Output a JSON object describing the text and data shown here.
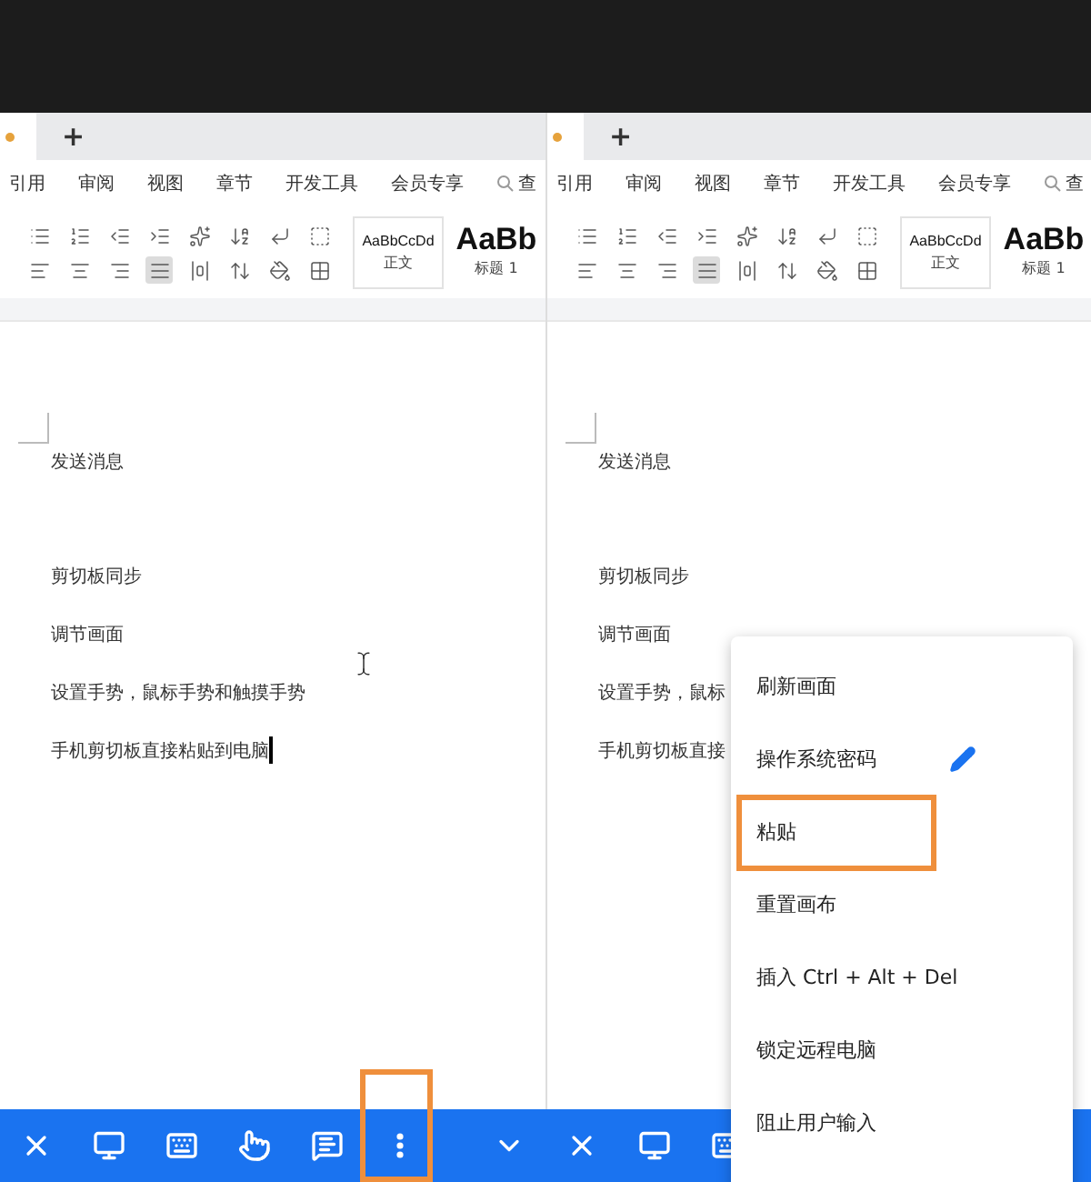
{
  "panes": [
    {
      "new_tab": "+",
      "ribbon_tabs": [
        "引用",
        "审阅",
        "视图",
        "章节",
        "开发工具",
        "会员专享",
        "查"
      ],
      "toolbar": [
        [
          {
            "kind": "bullets",
            "selected": false
          },
          {
            "kind": "numbers",
            "selected": false
          },
          {
            "kind": "outdent",
            "selected": false
          },
          {
            "kind": "indent",
            "selected": false
          },
          {
            "kind": "font",
            "selected": false
          },
          {
            "kind": "sort",
            "selected": false
          },
          {
            "kind": "return",
            "selected": false
          },
          {
            "kind": "marks",
            "selected": false
          }
        ],
        [
          {
            "kind": "align-left",
            "selected": false
          },
          {
            "kind": "align-center",
            "selected": false
          },
          {
            "kind": "align-right",
            "selected": false
          },
          {
            "kind": "justify",
            "selected": true
          },
          {
            "kind": "distribute",
            "selected": false
          },
          {
            "kind": "spacing",
            "selected": false
          },
          {
            "kind": "shading",
            "selected": false
          },
          {
            "kind": "borders",
            "selected": false
          }
        ]
      ],
      "styles": [
        {
          "kind": "small",
          "sample": "AaBbCcDd",
          "name": "正文"
        },
        {
          "kind": "large",
          "sample": "AaBb",
          "name": "标题 1"
        }
      ],
      "lines": [
        "发送消息",
        "剪切板同步",
        "调节画面",
        "设置手势，鼠标手势和触摸手势",
        "手机剪切板直接粘贴到电脑"
      ],
      "caret": true
    },
    {
      "new_tab": "+",
      "ribbon_tabs": [
        "引用",
        "审阅",
        "视图",
        "章节",
        "开发工具",
        "会员专享",
        "查"
      ],
      "toolbar": [
        [
          {
            "kind": "bullets",
            "selected": false
          },
          {
            "kind": "numbers",
            "selected": false
          },
          {
            "kind": "outdent",
            "selected": false
          },
          {
            "kind": "indent",
            "selected": false
          },
          {
            "kind": "font",
            "selected": false
          },
          {
            "kind": "sort",
            "selected": false
          },
          {
            "kind": "return",
            "selected": false
          },
          {
            "kind": "marks",
            "selected": false
          }
        ],
        [
          {
            "kind": "align-left",
            "selected": false
          },
          {
            "kind": "align-center",
            "selected": false
          },
          {
            "kind": "align-right",
            "selected": false
          },
          {
            "kind": "justify",
            "selected": true
          },
          {
            "kind": "distribute",
            "selected": false
          },
          {
            "kind": "spacing",
            "selected": false
          },
          {
            "kind": "shading",
            "selected": false
          },
          {
            "kind": "borders",
            "selected": false
          }
        ]
      ],
      "styles": [
        {
          "kind": "small",
          "sample": "AaBbCcDd",
          "name": "正文"
        },
        {
          "kind": "large",
          "sample": "AaBb",
          "name": "标题 1"
        }
      ],
      "lines": [
        "发送消息",
        "剪切板同步",
        "调节画面",
        "设置手势，鼠标",
        "手机剪切板直接"
      ],
      "caret": false
    }
  ],
  "bottom_bar": [
    {
      "kind": "close",
      "highlighted": false
    },
    {
      "kind": "monitor",
      "highlighted": false
    },
    {
      "kind": "keyboard",
      "highlighted": false
    },
    {
      "kind": "touch",
      "highlighted": false
    },
    {
      "kind": "message",
      "highlighted": false
    },
    {
      "kind": "more",
      "highlighted": true
    },
    {
      "kind": "chevron",
      "highlighted": false
    },
    {
      "kind": "close",
      "highlighted": false
    },
    {
      "kind": "monitor",
      "highlighted": false
    },
    {
      "kind": "keyboard",
      "highlighted": false
    }
  ],
  "menu": {
    "items": [
      {
        "label": "刷新画面",
        "highlighted": false,
        "edit_icon": false
      },
      {
        "label": "操作系统密码",
        "highlighted": false,
        "edit_icon": true
      },
      {
        "label": "粘贴",
        "highlighted": true,
        "edit_icon": false
      },
      {
        "label": "重置画布",
        "highlighted": false,
        "edit_icon": false
      },
      {
        "label": "插入 Ctrl + Alt + Del",
        "highlighted": false,
        "edit_icon": false
      },
      {
        "label": "锁定远程电脑",
        "highlighted": false,
        "edit_icon": false
      },
      {
        "label": "阻止用户输入",
        "highlighted": false,
        "edit_icon": false
      }
    ]
  }
}
